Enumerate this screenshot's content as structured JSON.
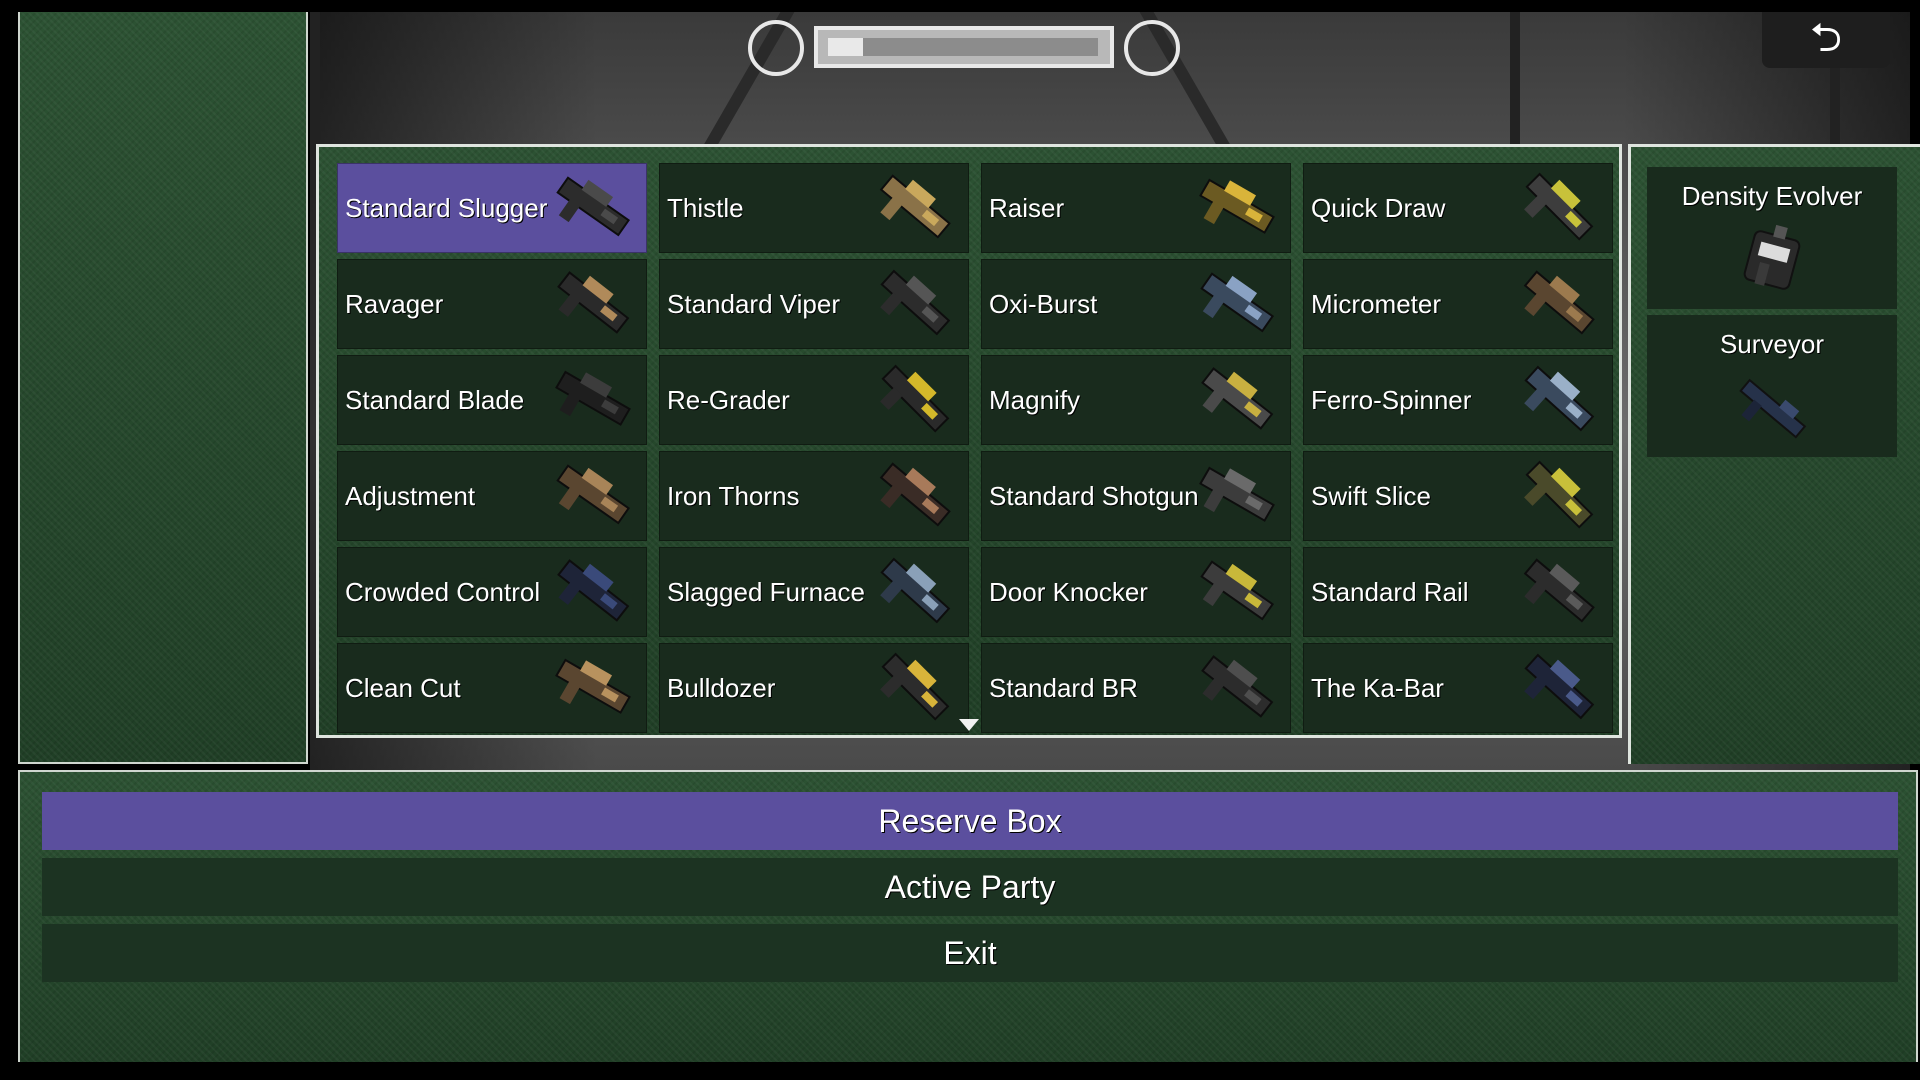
{
  "hud": {
    "back_icon": "back-arrow-icon",
    "back_glyph": "⮌",
    "health_fraction": 0.13
  },
  "weapons": [
    {
      "name": "Standard Slugger",
      "selected": true
    },
    {
      "name": "Thistle"
    },
    {
      "name": "Raiser"
    },
    {
      "name": "Quick Draw"
    },
    {
      "name": "Ravager"
    },
    {
      "name": "Standard Viper"
    },
    {
      "name": "Oxi-Burst"
    },
    {
      "name": "Micrometer"
    },
    {
      "name": "Standard Blade"
    },
    {
      "name": "Re-Grader"
    },
    {
      "name": "Magnify"
    },
    {
      "name": "Ferro-Spinner"
    },
    {
      "name": "Adjustment"
    },
    {
      "name": "Iron Thorns"
    },
    {
      "name": "Standard Shotgun"
    },
    {
      "name": "Swift Slice"
    },
    {
      "name": "Crowded Control"
    },
    {
      "name": "Slagged Furnace"
    },
    {
      "name": "Door Knocker"
    },
    {
      "name": "Standard Rail"
    },
    {
      "name": "Clean Cut"
    },
    {
      "name": "Bulldozer"
    },
    {
      "name": "Standard BR"
    },
    {
      "name": "The Ka-Bar"
    }
  ],
  "equipped": [
    {
      "name": "Density Evolver"
    },
    {
      "name": "Surveyor"
    }
  ],
  "menu": {
    "reserve_box": "Reserve Box",
    "active_party": "Active Party",
    "exit": "Exit"
  },
  "colors": {
    "selection": "#5b4f9e",
    "panel_green": "#274a2e",
    "cell_dark": "#192b1d"
  }
}
